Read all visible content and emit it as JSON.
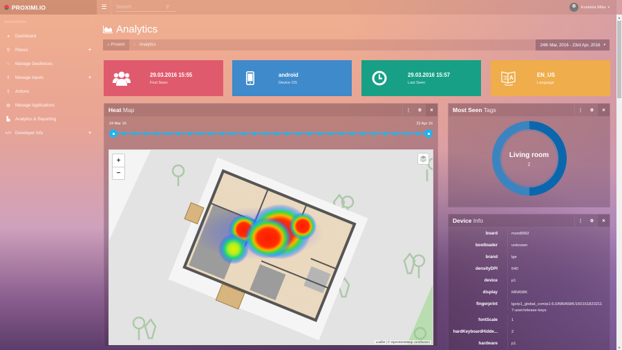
{
  "app": {
    "brand": "PROXIMI.IO",
    "search_placeholder": "Search . . .",
    "user_name": "Koskiola Mika"
  },
  "sidebar": {
    "heading": "NAVIGATION",
    "items": [
      {
        "label": "Dashboard",
        "icon": "dashboard-icon",
        "expandable": false
      },
      {
        "label": "Places",
        "icon": "map-marker-icon",
        "expandable": true
      },
      {
        "label": "Manage Geofences",
        "icon": "circle-icon",
        "expandable": false
      },
      {
        "label": "Manage Inputs",
        "icon": "upload-icon",
        "expandable": true
      },
      {
        "label": "Actions",
        "icon": "upload-icon",
        "expandable": false
      },
      {
        "label": "Manage Applications",
        "icon": "globe-icon",
        "expandable": false
      },
      {
        "label": "Analytics & Reporting",
        "icon": "area-chart-icon",
        "expandable": false
      },
      {
        "label": "Developer Info",
        "icon": "code-icon",
        "expandable": true
      }
    ]
  },
  "page": {
    "title": "Analytics",
    "breadcrumb": [
      "Proximi",
      "Analytics"
    ],
    "date_range": "24th Mar, 2016 - 23rd Apr, 2016"
  },
  "stats": [
    {
      "value": "29.03.2016 15:55",
      "label": "First Seen",
      "icon": "users-icon",
      "color": "#e05a6d"
    },
    {
      "value": "android",
      "label": "Device OS",
      "icon": "mobile-icon",
      "color": "#3f8acb"
    },
    {
      "value": "29.03.2016 15:57",
      "label": "Last Seen",
      "icon": "clock-icon",
      "color": "#17a085"
    },
    {
      "value": "EN_US",
      "label": "Language",
      "icon": "language-icon",
      "color": "#efad4c"
    }
  ],
  "heatmap": {
    "title_bold": "Heat",
    "title_rest": "Map",
    "slider": {
      "start_label": "24 Mar 16",
      "end_label": "22 Apr 16",
      "steps": 30,
      "selected_start": 0,
      "selected_end": 29,
      "color": "#1fb5ee"
    },
    "zoom_in": "+",
    "zoom_out": "−",
    "attribution": "Leaflet | © OpenStreetMap contributors"
  },
  "most_seen_tags": {
    "title_bold": "Most Seen",
    "title_rest": "Tags",
    "center_label": "Living room",
    "center_value": "2",
    "segments": [
      {
        "share": 0.5,
        "color": "#0a67ae"
      },
      {
        "share": 0.5,
        "color": "#3b84c0"
      }
    ]
  },
  "device_info": {
    "title_bold": "Device",
    "title_rest": "Info",
    "rows": [
      {
        "key": "board",
        "value": "msm8992"
      },
      {
        "key": "bootloader",
        "value": "unknown"
      },
      {
        "key": "brand",
        "value": "lge"
      },
      {
        "key": "densityDPI",
        "value": "640"
      },
      {
        "key": "device",
        "value": "p1"
      },
      {
        "key": "display",
        "value": "MRA58K"
      },
      {
        "key": "fingerprint",
        "value": "lge/p1_global_com/p1:6.0/MRA58K/1601518232117:user/release-keys"
      },
      {
        "key": "fontScale",
        "value": "1"
      },
      {
        "key": "hardKeyboardHidde...",
        "value": "2"
      },
      {
        "key": "hardware",
        "value": "p1"
      }
    ]
  }
}
